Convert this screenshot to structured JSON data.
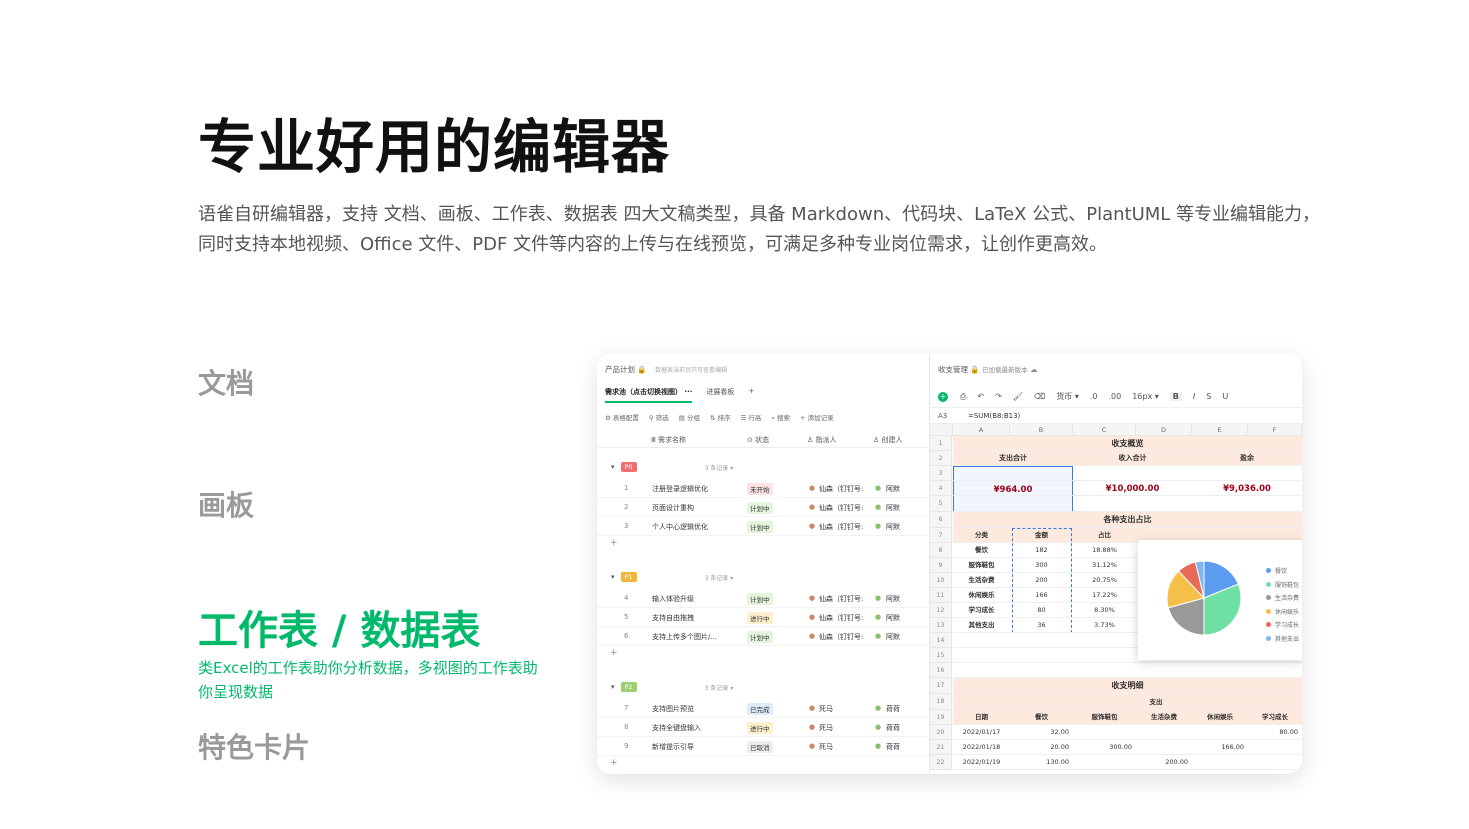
{
  "heading": "专业好用的编辑器",
  "description": "语雀自研编辑器，支持 文档、画板、工作表、数据表 四大文稿类型，具备 Markdown、代码块、LaTeX 公式、PlantUML 等专业编辑能力，同时支持本地视频、Office 文件、PDF 文件等内容的上传与在线预览，可满足多种专业岗位需求，让创作更高效。",
  "nav": {
    "doc": "文档",
    "board": "画板",
    "sheet": "工作表 / 数据表",
    "sheet_desc": "类Excel的工作表助你分析数据，多视图的工作表助你呈现数据",
    "card": "特色卡片"
  },
  "table_app": {
    "title": "产品计划",
    "hint": "数据表当前页只可查看编辑",
    "tabs": [
      "需求池（点击切换视图） ···",
      "进展看板",
      "+"
    ],
    "toolbar": [
      "⚙ 表格配置",
      "⚲ 筛选",
      "▤ 分组",
      "⇅ 排序",
      "☰ 行高",
      "⌕ 搜索",
      "+ 添加记录"
    ],
    "columns": [
      "Ⅲ 需求名称",
      "⊙ 状态",
      "♙ 指派人",
      "♙ 创建人"
    ],
    "groups": [
      {
        "tag": "P0",
        "color": "#f07070",
        "count": "3 条记录 ▾",
        "rows": [
          {
            "n": "1",
            "name": "注册登录逻辑优化",
            "status": "未开始",
            "assignee": "仙森（钉钉号:",
            "creator": "阿默"
          },
          {
            "n": "2",
            "name": "页面设计重构",
            "status": "计划中",
            "assignee": "仙森（钉钉号:",
            "creator": "阿默"
          },
          {
            "n": "3",
            "name": "个人中心逻辑优化",
            "status": "计划中",
            "assignee": "仙森（钉钉号:",
            "creator": "阿默"
          }
        ]
      },
      {
        "tag": "P1",
        "color": "#f2b53a",
        "count": "3 条记录 ▾",
        "rows": [
          {
            "n": "4",
            "name": "输入体验升级",
            "status": "计划中",
            "assignee": "仙森（钉钉号:",
            "creator": "阿默"
          },
          {
            "n": "5",
            "name": "支持自由拖拽",
            "status": "进行中",
            "assignee": "仙森（钉钉号:",
            "creator": "阿默"
          },
          {
            "n": "6",
            "name": "支持上传多个图片/...",
            "status": "计划中",
            "assignee": "仙森（钉钉号:",
            "creator": "阿默"
          }
        ]
      },
      {
        "tag": "P2",
        "color": "#9bd06d",
        "count": "3 条记录 ▾",
        "rows": [
          {
            "n": "7",
            "name": "支持图片预览",
            "status": "已完成",
            "assignee": "死马",
            "creator": "荷荷"
          },
          {
            "n": "8",
            "name": "支持全键盘输入",
            "status": "进行中",
            "assignee": "死马",
            "creator": "荷荷"
          },
          {
            "n": "9",
            "name": "新增提示引导",
            "status": "已取消",
            "assignee": "死马",
            "creator": "荷荷"
          }
        ]
      }
    ],
    "status_colors": {
      "未开始": "#fde2e2",
      "计划中": "#e4f5dc",
      "进行中": "#fdf0cf",
      "已完成": "#dcecfb",
      "已取消": "#ececec"
    }
  },
  "sheet_app": {
    "title": "收支管理",
    "saved": "已加载最新版本",
    "toolbar": [
      "⎙",
      "↶",
      "↷",
      "🖌",
      "⌫",
      "货币 ▾",
      ".0",
      ".00",
      "16px ▾",
      "B",
      "I",
      "S",
      "U"
    ],
    "cell_ref": "A3",
    "formula": "=SUM(B8:B13)",
    "col_letters": [
      "A",
      "B",
      "C",
      "D",
      "E",
      "F"
    ],
    "row_numbers": [
      "1",
      "2",
      "3",
      "4",
      "5",
      "6",
      "7",
      "8",
      "9",
      "10",
      "11",
      "12",
      "13",
      "14",
      "15",
      "16",
      "17",
      "18",
      "19",
      "20",
      "21",
      "22"
    ],
    "overview_title": "收支概览",
    "overview_headers": [
      "支出合计",
      "收入合计",
      "盈余"
    ],
    "overview_values": [
      "¥964.00",
      "¥10,000.00",
      "¥9,036.00"
    ],
    "ratio_title": "各种支出占比",
    "ratio_headers": [
      "分类",
      "金额",
      "占比"
    ],
    "ratio_rows": [
      [
        "餐饮",
        "182",
        "18.88%"
      ],
      [
        "服饰鞋包",
        "300",
        "31.12%"
      ],
      [
        "生活杂费",
        "200",
        "20.75%"
      ],
      [
        "休闲娱乐",
        "166",
        "17.22%"
      ],
      [
        "学习成长",
        "80",
        "8.30%"
      ],
      [
        "其他支出",
        "36",
        "3.73%"
      ]
    ],
    "detail_title": "收支明细",
    "detail_group": "支出",
    "detail_headers": [
      "日期",
      "餐饮",
      "服饰鞋包",
      "生活杂费",
      "休闲娱乐",
      "学习成长"
    ],
    "detail_rows": [
      [
        "2022/01/17",
        "32.00",
        "",
        "",
        "",
        "80.00"
      ],
      [
        "2022/01/18",
        "20.00",
        "300.00",
        "",
        "166.00",
        ""
      ],
      [
        "2022/01/19",
        "130.00",
        "",
        "200.00",
        "",
        ""
      ]
    ]
  },
  "chart_data": {
    "type": "pie",
    "categories": [
      "餐饮",
      "服饰鞋包",
      "生活杂费",
      "休闲娱乐",
      "学习成长",
      "其他支出"
    ],
    "values": [
      182,
      300,
      200,
      166,
      80,
      36
    ],
    "colors": [
      "#5b9bf0",
      "#6ee0a4",
      "#999999",
      "#f5c04a",
      "#ea6a5a",
      "#7fb8ee"
    ],
    "legend_labels": [
      "餐饮",
      "服饰鞋包",
      "生活杂费",
      "休闲娱乐",
      "学习成长",
      "其他支出"
    ],
    "legend_position": "right"
  }
}
